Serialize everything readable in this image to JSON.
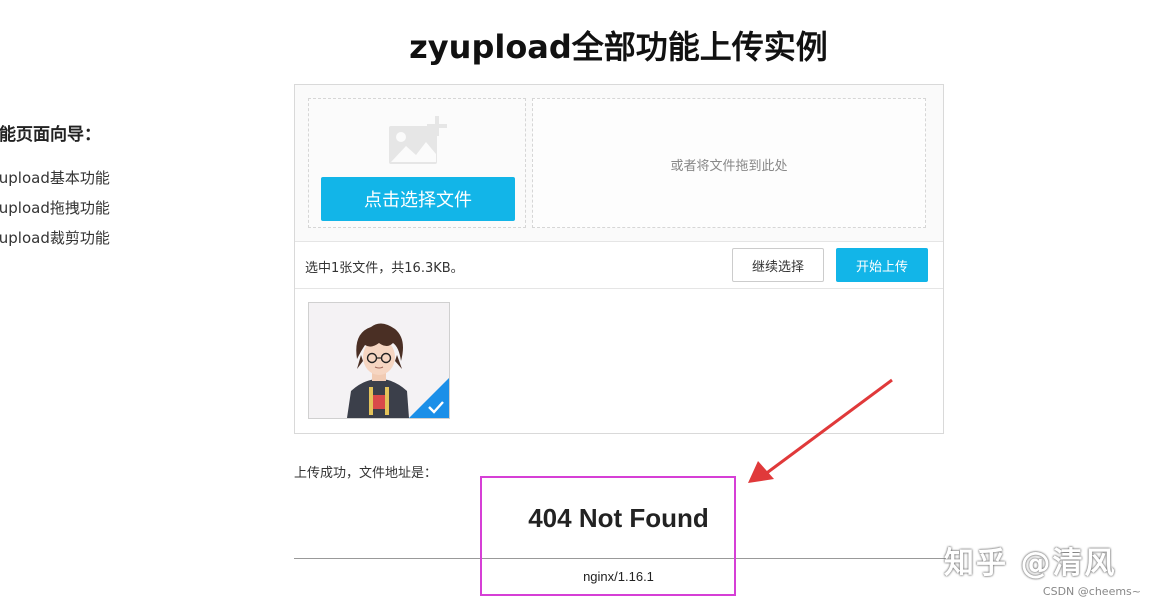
{
  "page": {
    "title": "zyupload全部功能上传实例"
  },
  "sidebar": {
    "heading": "功能页面向导：",
    "items": [
      {
        "label": "zyupload基本功能"
      },
      {
        "label": "zyupload拖拽功能"
      },
      {
        "label": "zyupload裁剪功能"
      }
    ]
  },
  "uploader": {
    "pick_button_label": "点击选择文件",
    "drop_hint": "或者将文件拖到此处",
    "status_text": "选中1张文件，共16.3KB。",
    "continue_label": "继续选择",
    "start_label": "开始上传",
    "thumbnail_selected": true
  },
  "result": {
    "label": "上传成功，文件地址是：",
    "error_title": "404 Not Found",
    "error_footer": "nginx/1.16.1"
  },
  "overlay": {
    "watermark": "知乎 @清风",
    "credit": "CSDN @cheems~"
  },
  "colors": {
    "accent": "#12b5e8",
    "highlight": "#d63fd6",
    "arrow": "#e0393a"
  },
  "icons": [
    "image-add-icon",
    "check-icon"
  ]
}
